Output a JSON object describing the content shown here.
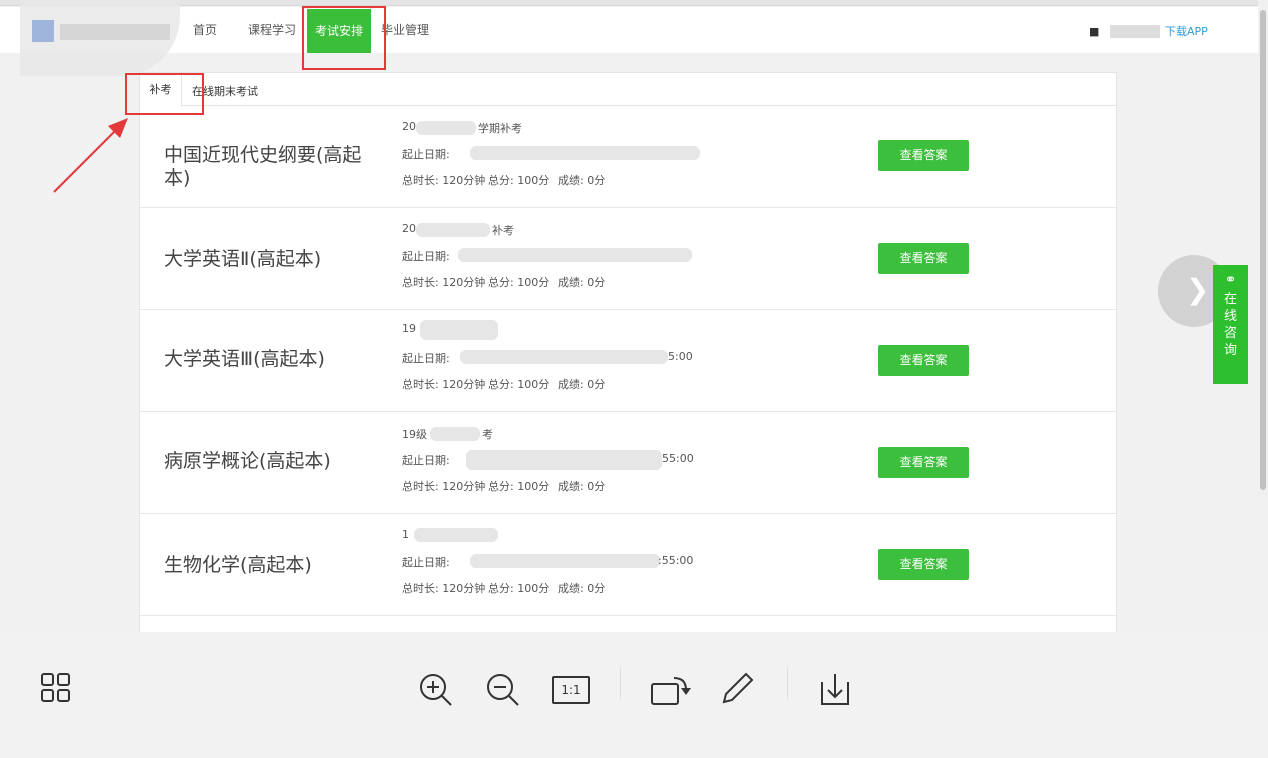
{
  "nav": {
    "items": [
      "首页",
      "课程学习",
      "考试安排",
      "毕业管理"
    ],
    "download": "下载APP",
    "user_icon": "user-icon"
  },
  "tabs": [
    "补考",
    "在线期末考试"
  ],
  "exams": [
    {
      "course": "中国近现代史纲要(高起本)",
      "term_prefix": "20",
      "term_suffix": "学期补考",
      "date_label": "起止日期:",
      "date_end": "",
      "duration": "总时长: 120分钟",
      "total": "总分: 100分",
      "score": "成绩: 0分",
      "button": "查看答案"
    },
    {
      "course": "大学英语Ⅱ(高起本)",
      "term_prefix": "20",
      "term_suffix": "补考",
      "date_label": "起止日期:",
      "date_end": "",
      "duration": "总时长: 120分钟",
      "total": "总分: 100分",
      "score": "成绩: 0分",
      "button": "查看答案"
    },
    {
      "course": "大学英语Ⅲ(高起本)",
      "term_prefix": "19",
      "term_suffix": "",
      "date_label": "起止日期:",
      "date_end": "5:00",
      "duration": "总时长: 120分钟",
      "total": "总分: 100分",
      "score": "成绩: 0分",
      "button": "查看答案"
    },
    {
      "course": "病原学概论(高起本)",
      "term_prefix": "19级",
      "term_suffix": "考",
      "date_label": "起止日期:",
      "date_end": "55:00",
      "duration": "总时长: 120分钟",
      "total": "总分: 100分",
      "score": "成绩: 0分",
      "button": "查看答案"
    },
    {
      "course": "生物化学(高起本)",
      "term_prefix": "1",
      "term_suffix": "",
      "date_label": "起止日期:",
      "date_end": ":55:00",
      "duration": "总时长: 120分钟",
      "total": "总分: 100分",
      "score": "成绩: 0分",
      "button": "查看答案"
    }
  ],
  "consult": {
    "icon": "headset-icon",
    "chars": [
      "在",
      "线",
      "咨",
      "询"
    ]
  },
  "toolbar": {
    "icons": [
      "grid-icon",
      "zoom-in-icon",
      "zoom-out-icon",
      "actual-size-icon",
      "rotate-icon",
      "edit-icon",
      "download-icon"
    ],
    "actual_size_label": "1:1"
  },
  "colors": {
    "accent": "#3cbf3c",
    "link": "#2f9ad8",
    "annotation": "#e23a3a"
  }
}
